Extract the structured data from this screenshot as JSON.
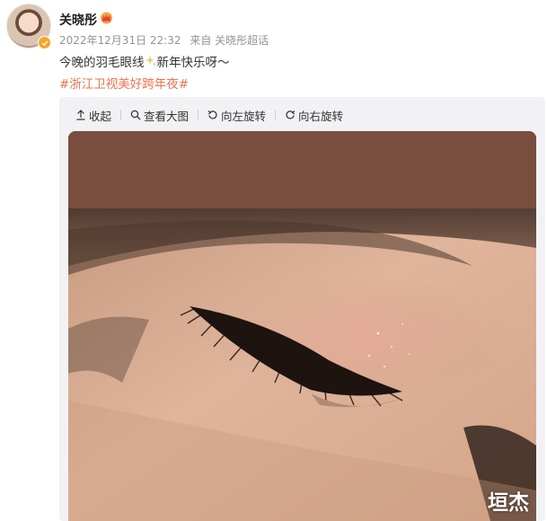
{
  "post": {
    "username": "关晓彤",
    "timestamp": "2022年12月31日 22:32",
    "source": "来自 关晓彤超话",
    "text_before": "今晚的羽毛眼线",
    "text_after": "新年快乐呀～",
    "hashtag": "#浙江卫视美好跨年夜#"
  },
  "toolbar": {
    "collapse_label": "收起",
    "view_large_label": "查看大图",
    "rotate_left_label": "向左旋转",
    "rotate_right_label": "向右旋转"
  },
  "image": {
    "watermark": "垣杰"
  },
  "colors": {
    "hashtag": "#eb7350",
    "meta": "#939393",
    "panel_bg": "#f2f2f5",
    "photo_top_band": "#7a4e3f"
  },
  "icons": [
    "avatar",
    "verified-badge-icon",
    "vip-crown-icon",
    "sparkle-emoji-icon",
    "collapse-arrow-icon",
    "zoom-icon",
    "rotate-left-icon",
    "rotate-right-icon"
  ]
}
